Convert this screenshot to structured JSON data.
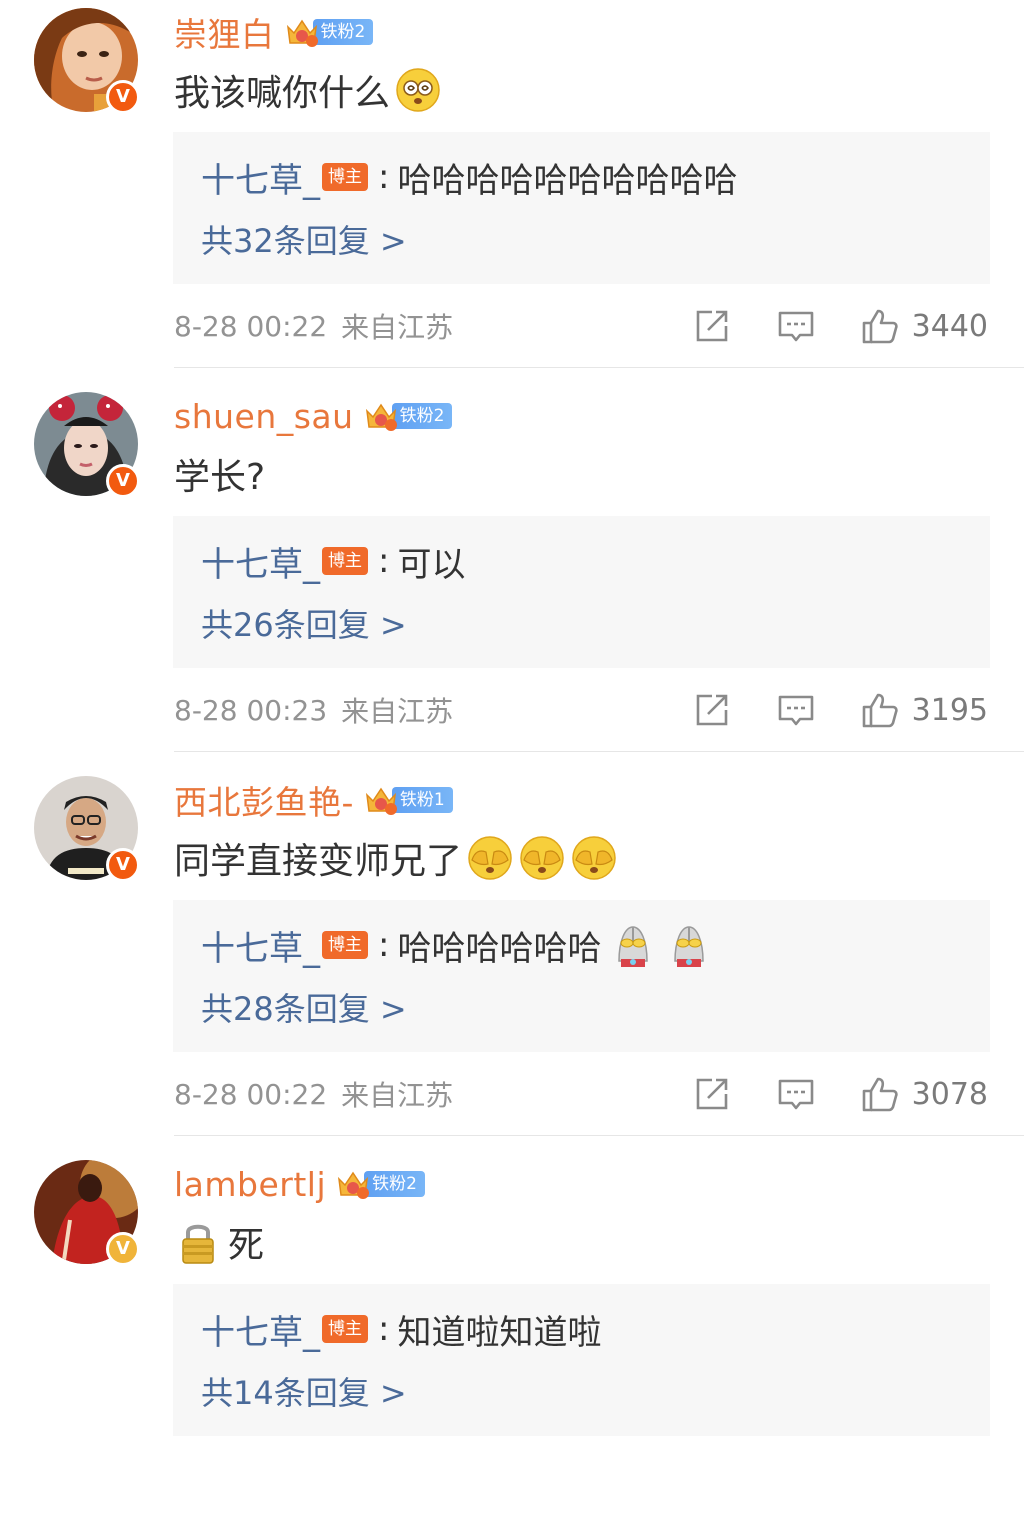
{
  "colors": {
    "username": "#e8773c",
    "reply_author": "#4a6a99",
    "blogger_tag": "#f06a2a",
    "fan_badge": "#6aa8f4",
    "meta_text": "#939393",
    "reply_box_bg": "#f7f7f7",
    "verified_badge_orange": "#f25a0f",
    "verified_badge_gold": "#f0b43a"
  },
  "comments": [
    {
      "username": "崇狸白",
      "fan_badge": "铁粉2",
      "verified": "V",
      "text": "我该喊你什么",
      "emojis": [
        "dizzy-face-emoji"
      ],
      "reply": {
        "author": "十七草_",
        "tag": "博主",
        "colon": ":",
        "content": "哈哈哈哈哈哈哈哈哈哈",
        "emojis": [],
        "count_label": "共32条回复 >"
      },
      "timestamp": "8-28 00:22",
      "location": "来自江苏",
      "likes": "3440"
    },
    {
      "username": "shuen_sau",
      "fan_badge": "铁粉2",
      "verified": "V",
      "text": "学长?",
      "emojis": [],
      "reply": {
        "author": "十七草_",
        "tag": "博主",
        "colon": ":",
        "content": "可以",
        "emojis": [],
        "count_label": "共26条回复 >"
      },
      "timestamp": "8-28 00:23",
      "location": "来自江苏",
      "likes": "3195"
    },
    {
      "username": "西北彭鱼艳-",
      "fan_badge": "铁粉1",
      "verified": "V",
      "text": "同学直接变师兄了",
      "emojis": [
        "face-covering-emoji",
        "face-covering-emoji",
        "face-covering-emoji"
      ],
      "reply": {
        "author": "十七草_",
        "tag": "博主",
        "colon": ":",
        "content": "哈哈哈哈哈哈",
        "emojis": [
          "ultraman-emoji",
          "ultraman-emoji"
        ],
        "count_label": "共28条回复 >"
      },
      "timestamp": "8-28 00:22",
      "location": "来自江苏",
      "likes": "3078"
    },
    {
      "username": "lambertlj",
      "fan_badge": "铁粉2",
      "verified": "V",
      "text": "死",
      "prefix_emoji": "lock-emoji",
      "emojis": [],
      "reply": {
        "author": "十七草_",
        "tag": "博主",
        "colon": ":",
        "content": "知道啦知道啦",
        "emojis": [],
        "count_label": "共14条回复 >"
      },
      "timestamp": "",
      "location": "",
      "likes": ""
    }
  ]
}
